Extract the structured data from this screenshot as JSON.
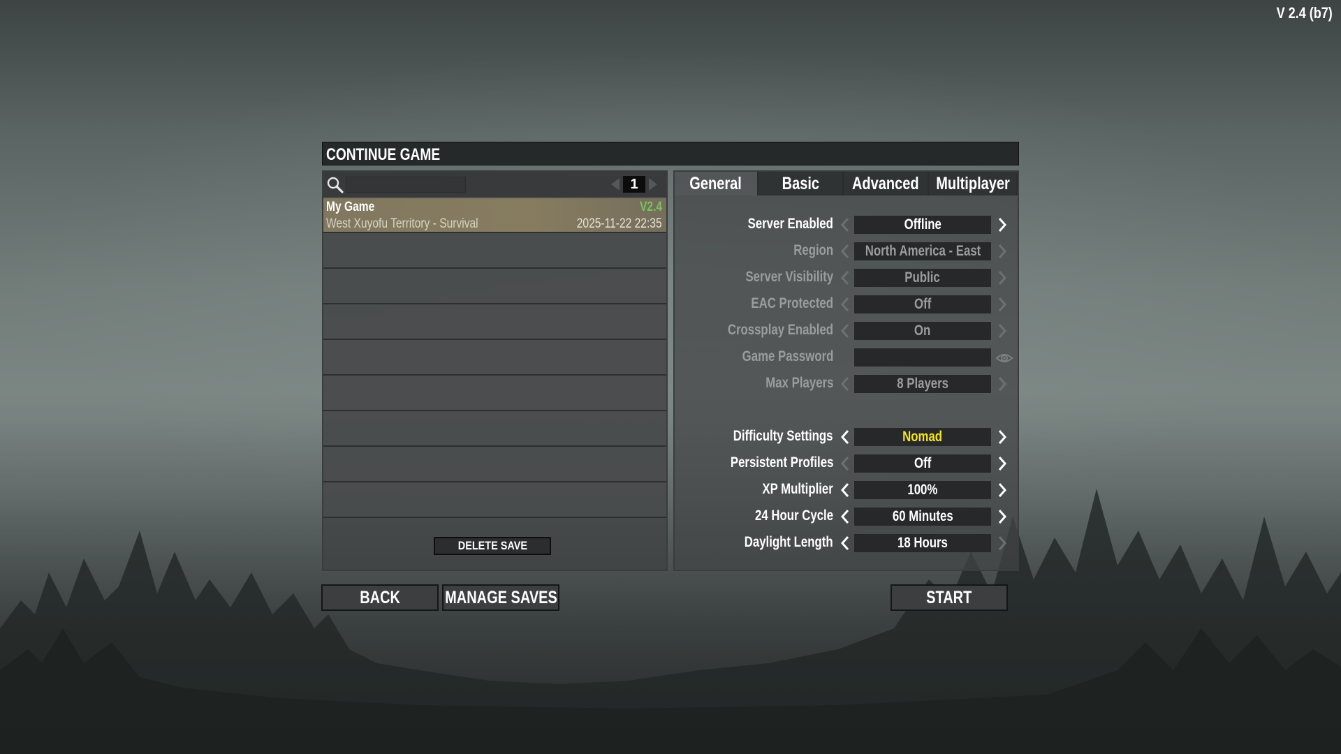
{
  "version": "V 2.4 (b7)",
  "window": {
    "title": "CONTINUE GAME"
  },
  "search": {
    "value": "",
    "placeholder": ""
  },
  "pager": {
    "page": "1"
  },
  "saves": [
    {
      "name": "My Game",
      "version": "V2.4",
      "world": "West Xuyofu Territory - Survival",
      "date": "2025-11-22 22:35"
    }
  ],
  "delete_label": "DELETE SAVE",
  "tabs": [
    "General",
    "Basic",
    "Advanced",
    "Multiplayer"
  ],
  "settings": {
    "server_enabled": {
      "label": "Server Enabled",
      "value": "Offline"
    },
    "region": {
      "label": "Region",
      "value": "North America - East"
    },
    "server_visibility": {
      "label": "Server Visibility",
      "value": "Public"
    },
    "eac_protected": {
      "label": "EAC Protected",
      "value": "Off"
    },
    "crossplay_enabled": {
      "label": "Crossplay Enabled",
      "value": "On"
    },
    "game_password": {
      "label": "Game Password",
      "value": ""
    },
    "max_players": {
      "label": "Max Players",
      "value": "8 Players"
    },
    "difficulty": {
      "label": "Difficulty Settings",
      "value": "Nomad"
    },
    "persistent_profiles": {
      "label": "Persistent Profiles",
      "value": "Off"
    },
    "xp_multiplier": {
      "label": "XP Multiplier",
      "value": "100%"
    },
    "day_cycle": {
      "label": "24 Hour Cycle",
      "value": "60 Minutes"
    },
    "daylight_length": {
      "label": "Daylight Length",
      "value": "18 Hours"
    }
  },
  "buttons": {
    "back": "BACK",
    "manage_saves": "MANAGE SAVES",
    "start": "START"
  },
  "colors": {
    "accent_yellow": "#f4e21b",
    "version_green": "#78c25e",
    "selected_row": "#857b60"
  },
  "icons": {
    "search": "search-icon",
    "eye": "eye-icon",
    "arrows": "chevron-left-icon / chevron-right-icon"
  }
}
